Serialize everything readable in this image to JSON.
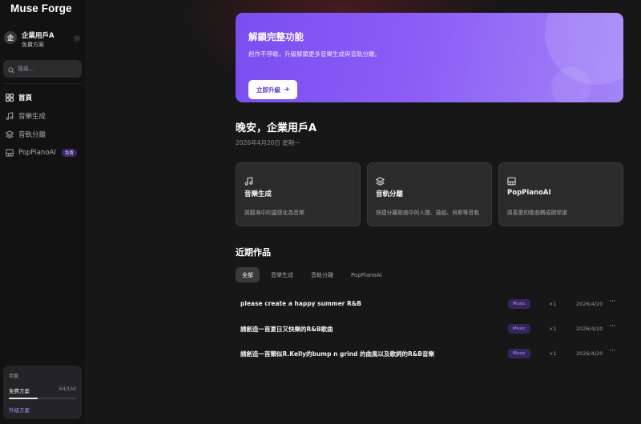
{
  "brand": {
    "logo_text": "Muse Forge",
    "accent": "#8b5cf6"
  },
  "user": {
    "avatar_initial": "企",
    "name": "企業用戶A",
    "plan": "免費方案"
  },
  "sidebar": {
    "search_placeholder": "搜尋...",
    "nav": [
      {
        "label": "首頁",
        "icon": "grid-icon",
        "active": true
      },
      {
        "label": "音樂生成",
        "icon": "music-note-icon",
        "active": false
      },
      {
        "label": "音軌分離",
        "icon": "layers-icon",
        "active": false
      },
      {
        "label": "PopPianoAI",
        "icon": "piano-icon",
        "active": false,
        "badge": "免費"
      }
    ],
    "usage": {
      "title": "用量",
      "plan_label": "免費方案",
      "count_text": "64/150",
      "used": 64,
      "total": 150,
      "upgrade_label": "升級方案"
    }
  },
  "banner": {
    "title": "解鎖完整功能",
    "description": "創作不停歇，升級解鎖更多音樂生成與音軌分離。",
    "button_label": "立即升級",
    "button_icon": "arrow-right-icon"
  },
  "greeting": {
    "text": "晚安，企業用戶A",
    "date": "2026年4月20日 星期一"
  },
  "features": [
    {
      "icon": "music-note-icon",
      "title": "音樂生成",
      "description": "將腦海中的靈感化為音樂"
    },
    {
      "icon": "layers-icon",
      "title": "音軌分離",
      "description": "快捷分離歌曲中的人聲、鼓組、貝斯等音軌"
    },
    {
      "icon": "piano-icon",
      "title": "PopPianoAI",
      "description": "將喜愛的歌曲轉成鋼琴譜"
    }
  ],
  "recent": {
    "title": "近期作品",
    "filters": [
      {
        "label": "全部",
        "active": true
      },
      {
        "label": "音樂生成",
        "active": false
      },
      {
        "label": "音軌分離",
        "active": false
      },
      {
        "label": "PopPianoAI",
        "active": false
      }
    ],
    "rows": [
      {
        "title": "please create a happy summer R&B",
        "tag": "Music",
        "count": "×1",
        "date": "2026/4/20",
        "more": "···"
      },
      {
        "title": "請創造一首夏日又快樂的R&B歌曲",
        "tag": "Music",
        "count": "×1",
        "date": "2026/4/20",
        "more": "···"
      },
      {
        "title": "請創造一首類似R.Kelly的bump n grind 的曲風以及歌詞的R&B音樂",
        "tag": "Music",
        "count": "×1",
        "date": "2026/4/20",
        "more": "···"
      }
    ]
  }
}
